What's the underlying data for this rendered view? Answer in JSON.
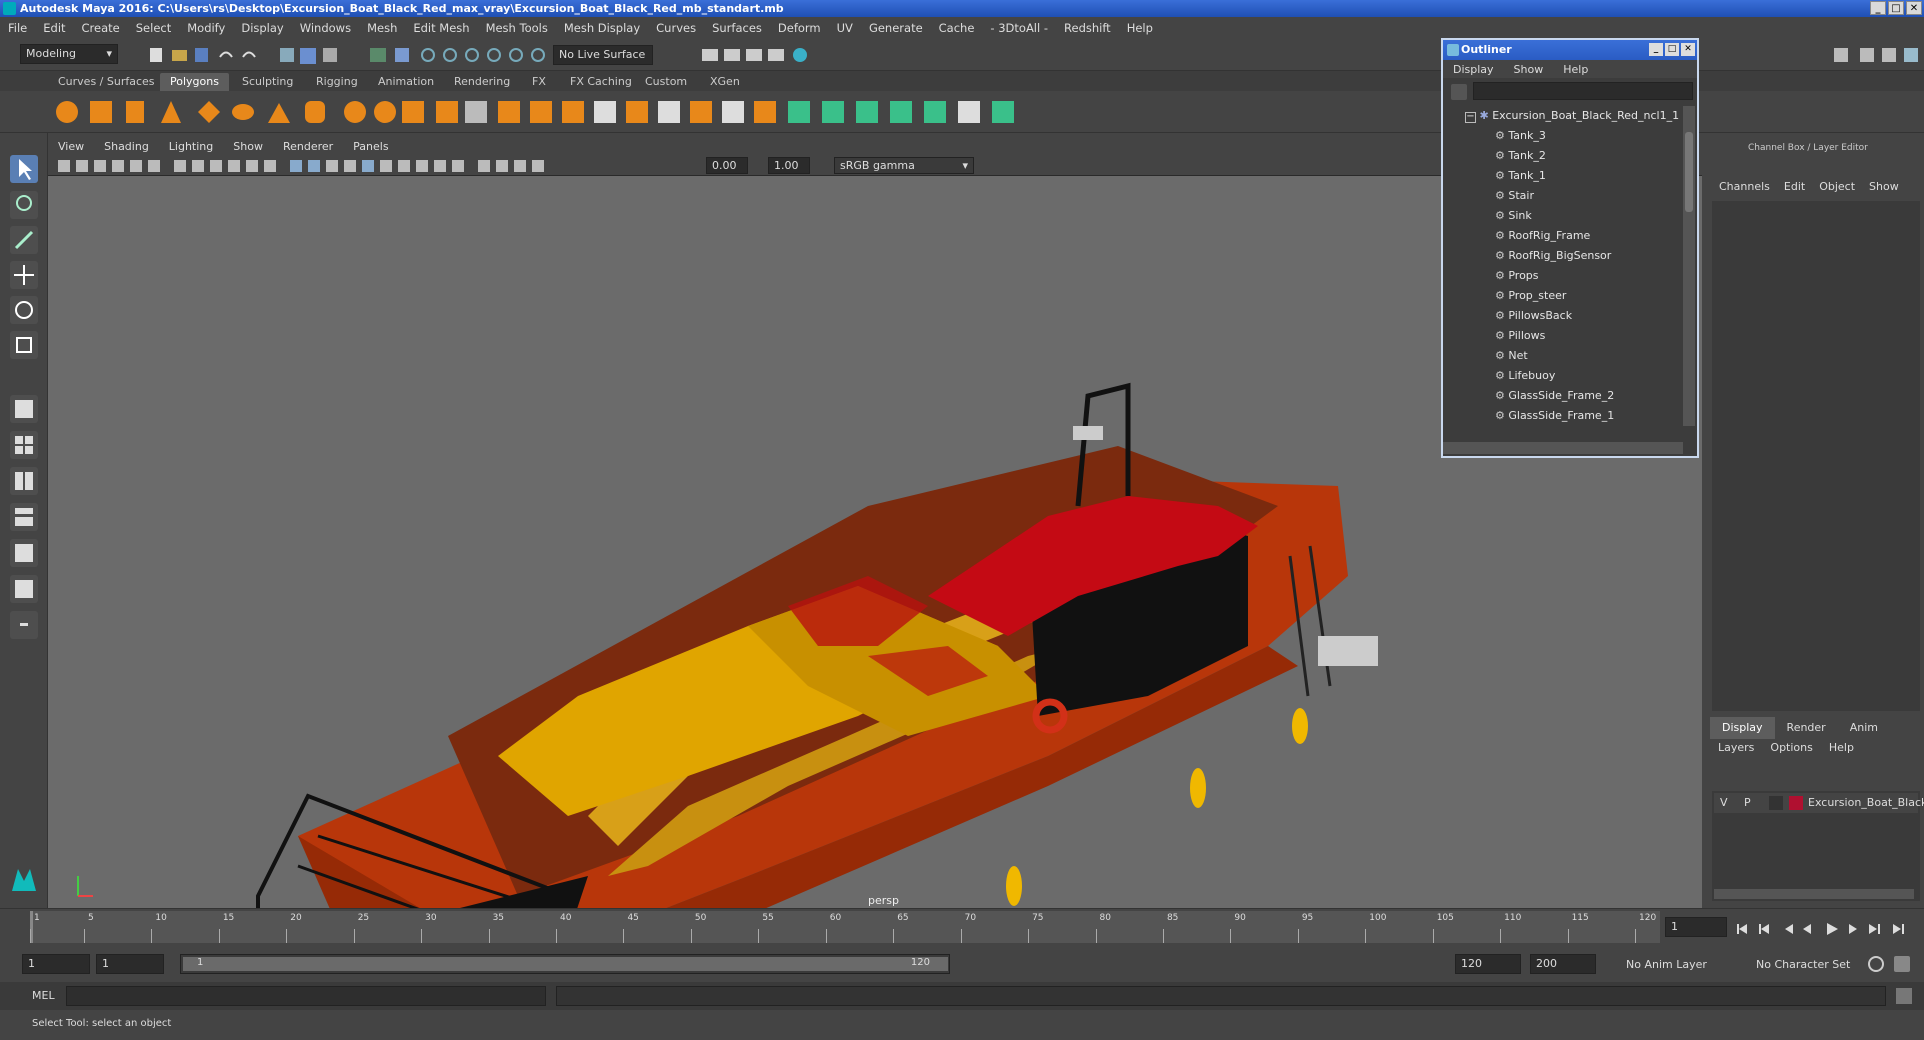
{
  "title": "Autodesk Maya 2016: C:\\Users\\rs\\Desktop\\Excursion_Boat_Black_Red_max_vray\\Excursion_Boat_Black_Red_mb_standart.mb",
  "menu": [
    "File",
    "Edit",
    "Create",
    "Select",
    "Modify",
    "Display",
    "Windows",
    "Mesh",
    "Edit Mesh",
    "Mesh Tools",
    "Mesh Display",
    "Curves",
    "Surfaces",
    "Deform",
    "UV",
    "Generate",
    "Cache",
    "- 3DtoAll -",
    "Redshift",
    "Help"
  ],
  "status": {
    "mode": "Modeling",
    "live_surface": "No Live Surface"
  },
  "shelf_tabs": [
    "Curves / Surfaces",
    "Polygons",
    "Sculpting",
    "Rigging",
    "Animation",
    "Rendering",
    "FX",
    "FX Caching",
    "Custom",
    "XGen"
  ],
  "active_shelf": "Polygons",
  "panel_menu": [
    "View",
    "Shading",
    "Lighting",
    "Show",
    "Renderer",
    "Panels"
  ],
  "panel_tools": {
    "exposure": "0.00",
    "gamma": "1.00",
    "color_space": "sRGB gamma"
  },
  "viewport": {
    "camera": "persp"
  },
  "outliner": {
    "title": "Outliner",
    "menu": [
      "Display",
      "Show",
      "Help"
    ],
    "root": "Excursion_Boat_Black_Red_ncl1_1",
    "items": [
      "Tank_3",
      "Tank_2",
      "Tank_1",
      "Stair",
      "Sink",
      "RoofRig_Frame",
      "RoofRig_BigSensor",
      "Props",
      "Prop_steer",
      "PillowsBack",
      "Pillows",
      "Net",
      "Lifebuoy",
      "GlassSide_Frame_2",
      "GlassSide_Frame_1"
    ]
  },
  "channel_box": {
    "title": "Channel Box / Layer Editor",
    "menu": [
      "Channels",
      "Edit",
      "Object",
      "Show"
    ],
    "layer_tabs": [
      "Display",
      "Render",
      "Anim"
    ],
    "layer_menu": [
      "Layers",
      "Options",
      "Help"
    ],
    "layer": {
      "v": "V",
      "p": "P",
      "name": "Excursion_Boat_Black_",
      "color": "#b01030"
    }
  },
  "timeline": {
    "ticks": [
      "1",
      "5",
      "10",
      "15",
      "20",
      "25",
      "30",
      "35",
      "40",
      "45",
      "50",
      "55",
      "60",
      "65",
      "70",
      "75",
      "80",
      "85",
      "90",
      "95",
      "100",
      "105",
      "110",
      "115",
      "120"
    ],
    "current_frame": "1"
  },
  "range": {
    "start": "1",
    "anim_start": "1",
    "slider_start": "1",
    "slider_end": "120",
    "end": "120",
    "anim_end": "200",
    "anim_layer": "No Anim Layer",
    "char_set": "No Character Set"
  },
  "command": {
    "lang": "MEL"
  },
  "help_line": "Select Tool: select an object"
}
